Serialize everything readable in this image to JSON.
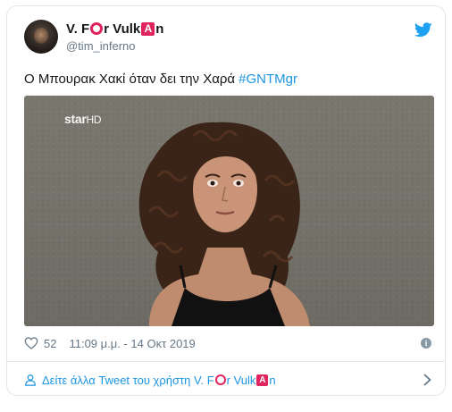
{
  "user": {
    "name_part1": "V. F",
    "name_part2": "r Vulk",
    "name_part3": "n",
    "emoji_a_letter": "A",
    "handle": "@tim_inferno"
  },
  "tweet": {
    "text": "Ο Μπουρακ Χακί όταν δει την Χαρά",
    "hashtag": "#GNTMgr"
  },
  "media": {
    "watermark": "star",
    "watermark_hd": "HD"
  },
  "stats": {
    "likes": "52",
    "timestamp": "11:09 μ.μ. - 14 Οκτ 2019",
    "info_glyph": "i"
  },
  "footer": {
    "more_prefix": "Δείτε άλλα Tweet του χρήστη V. F",
    "more_mid": "r Vulk",
    "more_end": "n",
    "emoji_a_letter": "A"
  },
  "colors": {
    "link": "#1b95e0",
    "heart": "#657786",
    "emoji_red": "#e0245e"
  },
  "icons": [
    "twitter-bird-icon",
    "heart-icon",
    "info-icon",
    "person-icon",
    "chevron-right-icon"
  ]
}
